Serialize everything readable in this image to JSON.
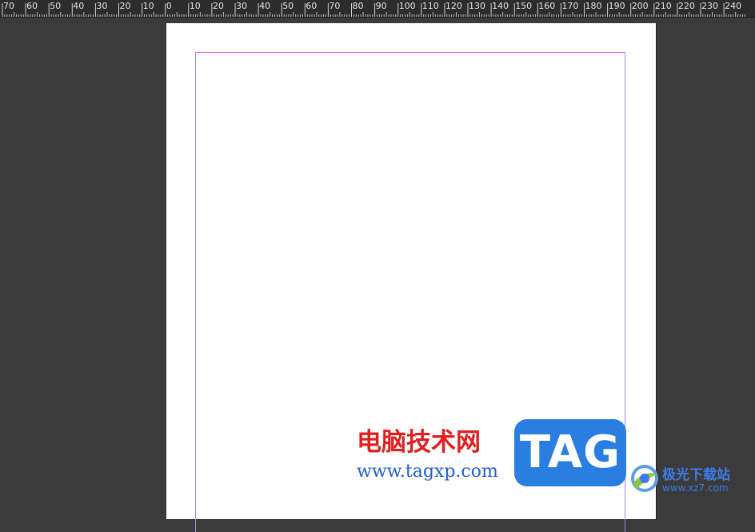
{
  "ruler": {
    "labels": [
      "70",
      "60",
      "50",
      "40",
      "30",
      "20",
      "10",
      "0",
      "10",
      "20",
      "30",
      "40",
      "50",
      "60",
      "70",
      "80",
      "90",
      "100",
      "110",
      "120",
      "130",
      "140",
      "150",
      "160",
      "170",
      "180",
      "190",
      "200",
      "210",
      "220",
      "230",
      "240"
    ]
  },
  "watermark": {
    "site_cn": "电脑技术网",
    "site_url": "www.tagxp.com",
    "tag": "TAG",
    "partner_cn": "极光下载站",
    "partner_url": "www.xz7.com"
  },
  "colors": {
    "pasteboard": "#3b3b3b",
    "ruler": "#2c2c2c",
    "page": "#ffffff",
    "margin_guide_top": "#d46ad8",
    "margin_guide_side": "#9a8fdc",
    "watermark_red": "#e02020",
    "watermark_blue": "#2a7de1"
  }
}
